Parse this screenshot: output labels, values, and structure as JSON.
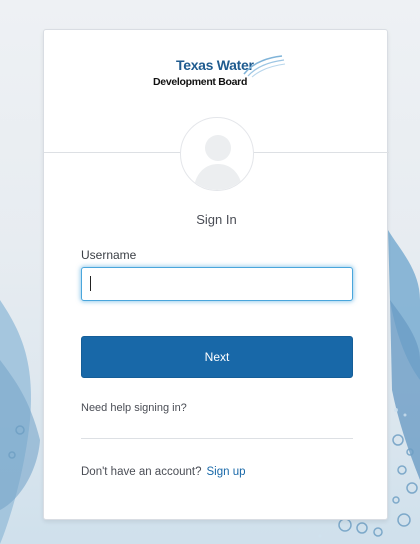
{
  "logo": {
    "line1": "Texas Water",
    "line2": "Development Board"
  },
  "form": {
    "title": "Sign In",
    "username_label": "Username",
    "username_value": "",
    "next_label": "Next",
    "help_link": "Need help signing in?",
    "signup_prompt": "Don't have an account?",
    "signup_link": "Sign up"
  },
  "colors": {
    "primary_button": "#1868a8",
    "input_focus": "#4aa6dc",
    "logo_blue": "#1f5b8f"
  }
}
